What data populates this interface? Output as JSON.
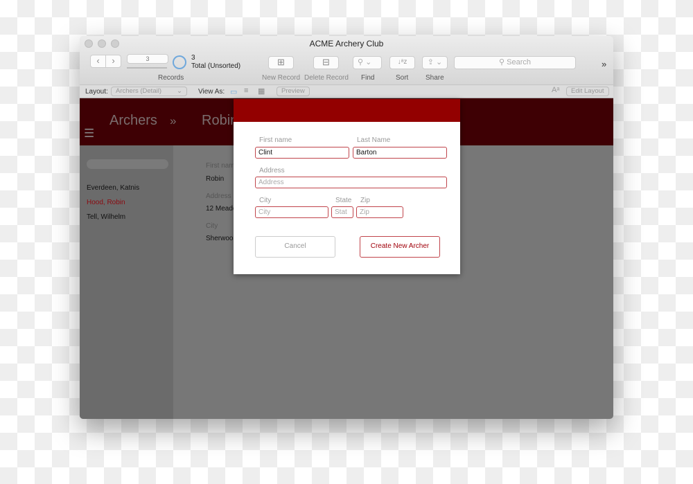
{
  "window": {
    "title": "ACME Archery Club"
  },
  "toolbar": {
    "record_number": "3",
    "record_count": "3",
    "total_label": "Total (Unsorted)",
    "records_label": "Records",
    "new_record": "New Record",
    "delete_record": "Delete Record",
    "find": "Find",
    "sort": "Sort",
    "share": "Share",
    "search_placeholder": "Search",
    "overflow": "»"
  },
  "layoutbar": {
    "layout_label": "Layout:",
    "layout_value": "Archers (Detail)",
    "view_as": "View As:",
    "preview": "Preview",
    "edit_layout": "Edit Layout"
  },
  "header": {
    "crumb": "Archers",
    "sep": "»",
    "current": "Robin"
  },
  "sidebar": {
    "items": [
      {
        "label": "Everdeen, Katnis"
      },
      {
        "label": "Hood, Robin"
      },
      {
        "label": "Tell, Wilhelm"
      }
    ]
  },
  "detail": {
    "first_label": "First name",
    "first_value": "Robin",
    "address_label": "Address",
    "address_value": "12 Meadow",
    "city_label": "City",
    "city_value": "Sherwood"
  },
  "dialog": {
    "first_label": "First name",
    "first_value": "Clint",
    "last_label": "Last Name",
    "last_value": "Barton",
    "address_label": "Address",
    "address_placeholder": "Address",
    "city_label": "City",
    "city_placeholder": "City",
    "state_label": "State",
    "state_placeholder": "Stat",
    "zip_label": "Zip",
    "zip_placeholder": "Zip",
    "cancel": "Cancel",
    "create": "Create New Archer"
  },
  "colors": {
    "accent": "#930000",
    "header": "#3e0004",
    "selected": "#8b0a10"
  }
}
